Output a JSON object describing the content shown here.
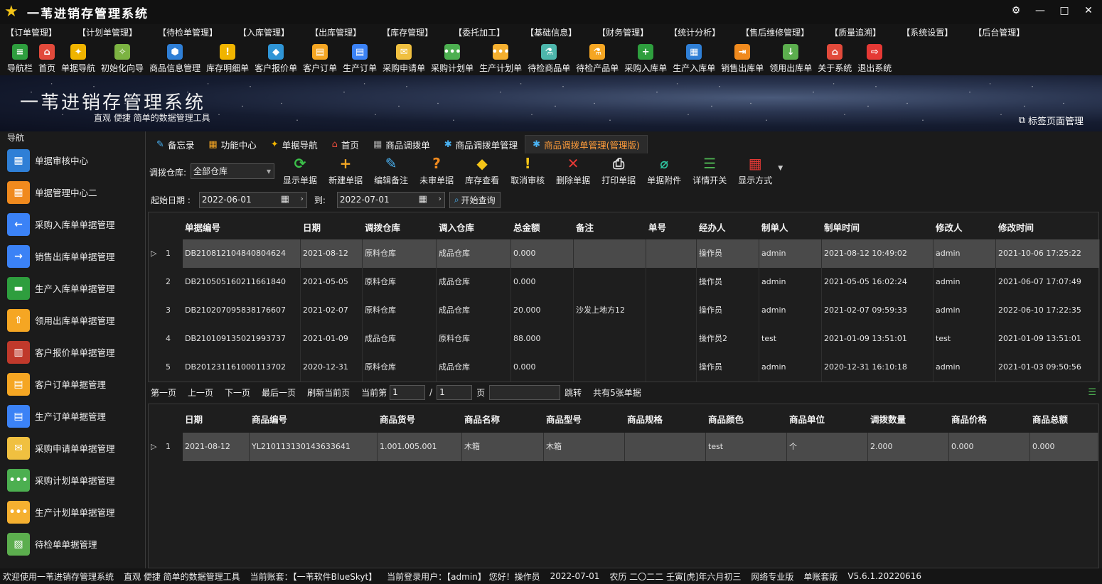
{
  "window": {
    "title": "一苇进销存管理系统",
    "buttons": [
      "⚙",
      "—",
      "□",
      "✕"
    ]
  },
  "menu": [
    "【订单管理】",
    "【计划单管理】",
    "【待检单管理】",
    "【入库管理】",
    "【出库管理】",
    "【库存管理】",
    "【委托加工】",
    "【基础信息】",
    "【财务管理】",
    "【统计分析】",
    "【售后维修管理】",
    "【质量追溯】",
    "【系统设置】",
    "【后台管理】"
  ],
  "toolbar": [
    {
      "label": "导航栏",
      "icon": "≡",
      "color": "#2e9e3e"
    },
    {
      "label": "首页",
      "icon": "⌂",
      "color": "#e24a3b"
    },
    {
      "label": "单据导航",
      "icon": "✦",
      "color": "#f0b400"
    },
    {
      "label": "初始化向导",
      "icon": "✧",
      "color": "#7cb342"
    },
    {
      "label": "商品信息管理",
      "icon": "⬢",
      "color": "#2f7fd6"
    },
    {
      "label": "库存明细单",
      "icon": "!",
      "color": "#f0b400"
    },
    {
      "label": "客户报价单",
      "icon": "◆",
      "color": "#2f95d6"
    },
    {
      "label": "客户订单",
      "icon": "▤",
      "color": "#f5a623"
    },
    {
      "label": "生产订单",
      "icon": "▤",
      "color": "#3b82f6"
    },
    {
      "label": "采购申请单",
      "icon": "✉",
      "color": "#f0c040"
    },
    {
      "label": "采购计划单",
      "icon": "•••",
      "color": "#4caf50"
    },
    {
      "label": "生产计划单",
      "icon": "•••",
      "color": "#f5b030"
    },
    {
      "label": "待检商品单",
      "icon": "⚗",
      "color": "#4db6ac"
    },
    {
      "label": "待检产品单",
      "icon": "⚗",
      "color": "#f5a623"
    },
    {
      "label": "采购入库单",
      "icon": "+",
      "color": "#2e9e3e"
    },
    {
      "label": "生产入库单",
      "icon": "▦",
      "color": "#2f7fd6"
    },
    {
      "label": "销售出库单",
      "icon": "⇥",
      "color": "#f08a1e"
    },
    {
      "label": "领用出库单",
      "icon": "↓",
      "color": "#5cae4e"
    },
    {
      "label": "关于系统",
      "icon": "⌂",
      "color": "#e24a3b"
    },
    {
      "label": "退出系统",
      "icon": "⇨",
      "color": "#e53935"
    }
  ],
  "banner": {
    "title": "一苇进销存管理系统",
    "subtitle": "直观  便捷  简单的数据管理工具",
    "tag_manager": "标签页面管理"
  },
  "nav": {
    "header": "导航",
    "items": [
      {
        "label": "单据审核中心",
        "icon": "▦",
        "color": "#2f7fd6"
      },
      {
        "label": "单据管理中心二",
        "icon": "▦",
        "color": "#f08a1e"
      },
      {
        "label": "采购入库单单据管理",
        "icon": "←",
        "color": "#3b82f6"
      },
      {
        "label": "销售出库单单据管理",
        "icon": "→",
        "color": "#3b82f6"
      },
      {
        "label": "生产入库单单据管理",
        "icon": "▬",
        "color": "#2e9e3e"
      },
      {
        "label": "领用出库单单据管理",
        "icon": "⇧",
        "color": "#f5a623"
      },
      {
        "label": "客户报价单单据管理",
        "icon": "▥",
        "color": "#c0392b"
      },
      {
        "label": "客户订单单据管理",
        "icon": "▤",
        "color": "#f5a623"
      },
      {
        "label": "生产订单单据管理",
        "icon": "▤",
        "color": "#3b82f6"
      },
      {
        "label": "采购申请单单据管理",
        "icon": "✉",
        "color": "#f0c040"
      },
      {
        "label": "采购计划单单据管理",
        "icon": "•••",
        "color": "#4caf50"
      },
      {
        "label": "生产计划单单据管理",
        "icon": "•••",
        "color": "#f5b030"
      },
      {
        "label": "待检单单据管理",
        "icon": "▧",
        "color": "#5cae4e"
      }
    ]
  },
  "tabs": [
    {
      "label": "备忘录",
      "icon": "✎",
      "color": "#4ab3f4"
    },
    {
      "label": "功能中心",
      "icon": "▦",
      "color": "#f5a623"
    },
    {
      "label": "单据导航",
      "icon": "✦",
      "color": "#f0b400"
    },
    {
      "label": "首页",
      "icon": "⌂",
      "color": "#e24a3b"
    },
    {
      "label": "商品调拨单",
      "icon": "▦",
      "color": "#aaa"
    },
    {
      "label": "商品调拨单管理",
      "icon": "✱",
      "color": "#4ab3f4"
    },
    {
      "label": "商品调拨单管理(管理版)",
      "icon": "✱",
      "color": "#4ab3f4",
      "active": true
    }
  ],
  "filters": {
    "warehouse_label": "调拨仓库:",
    "warehouse_value": "全部仓库",
    "start_label": "起始日期 :",
    "start_value": "2022-06-01",
    "to_label": "到:",
    "end_value": "2022-07-01",
    "query_label": "开始查询"
  },
  "actions": [
    {
      "label": "显示单据",
      "icon": "⟳",
      "color": "#3cc24a"
    },
    {
      "label": "新建单据",
      "icon": "+",
      "color": "#f5a623"
    },
    {
      "label": "编辑备注",
      "icon": "✎",
      "color": "#4ab3f4"
    },
    {
      "label": "未审单据",
      "icon": "?",
      "color": "#f08a1e"
    },
    {
      "label": "库存查看",
      "icon": "◆",
      "color": "#f5c518"
    },
    {
      "label": "取消审核",
      "icon": "!",
      "color": "#f5c518"
    },
    {
      "label": "删除单据",
      "icon": "✕",
      "color": "#e53935"
    },
    {
      "label": "打印单据",
      "icon": "⎙",
      "color": "#e0e0e0"
    },
    {
      "label": "单据附件",
      "icon": "⌀",
      "color": "#2ec4a0"
    },
    {
      "label": "详情开关",
      "icon": "☰",
      "color": "#4caf50"
    },
    {
      "label": "显示方式",
      "icon": "▦",
      "color": "#e53935"
    }
  ],
  "master_grid": {
    "headers": [
      "单据编号",
      "日期",
      "调拨仓库",
      "调入仓库",
      "总金额",
      "备注",
      "单号",
      "经办人",
      "制单人",
      "制单时间",
      "修改人",
      "修改时间"
    ],
    "rows": [
      {
        "n": "1",
        "c": [
          "DB210812104840804624",
          "2021-08-12",
          "原料仓库",
          "成品仓库",
          "0.000",
          "",
          "",
          "操作员",
          "admin",
          "2021-08-12 10:49:02",
          "admin",
          "2021-10-06 17:25:22"
        ]
      },
      {
        "n": "2",
        "c": [
          "DB210505160211661840",
          "2021-05-05",
          "原料仓库",
          "成品仓库",
          "0.000",
          "",
          "",
          "操作员",
          "admin",
          "2021-05-05 16:02:24",
          "admin",
          "2021-06-07 17:07:49"
        ]
      },
      {
        "n": "3",
        "c": [
          "DB210207095838176607",
          "2021-02-07",
          "原料仓库",
          "成品仓库",
          "20.000",
          "沙发上地方12",
          "",
          "操作员",
          "admin",
          "2021-02-07 09:59:33",
          "admin",
          "2022-06-10 17:22:35"
        ]
      },
      {
        "n": "4",
        "c": [
          "DB210109135021993737",
          "2021-01-09",
          "成品仓库",
          "原料仓库",
          "88.000",
          "",
          "",
          "操作员2",
          "test",
          "2021-01-09 13:51:01",
          "test",
          "2021-01-09 13:51:01"
        ]
      },
      {
        "n": "5",
        "c": [
          "DB201231161000113702",
          "2020-12-31",
          "原料仓库",
          "成品仓库",
          "0.000",
          "",
          "",
          "操作员",
          "admin",
          "2020-12-31 16:10:18",
          "admin",
          "2021-01-03 09:50:56"
        ]
      }
    ]
  },
  "pager": {
    "first": "第一页",
    "prev": "上一页",
    "next": "下一页",
    "last": "最后一页",
    "refresh": "刷新当前页",
    "current_label": "当前第",
    "current": "1",
    "slash": "/",
    "total_pages": "1",
    "page_unit": "页",
    "jump_value": "",
    "jump_label": "跳转",
    "total_text": "共有5张单据"
  },
  "detail_grid": {
    "headers": [
      "日期",
      "商品编号",
      "商品货号",
      "商品名称",
      "商品型号",
      "商品规格",
      "商品颜色",
      "商品单位",
      "调拨数量",
      "商品价格",
      "商品总额"
    ],
    "rows": [
      {
        "n": "1",
        "c": [
          "2021-08-12",
          "YL210113130143633641",
          "1.001.005.001",
          "木箱",
          "木箱",
          "",
          "test",
          "个",
          "2.000",
          "0.000",
          "0.000"
        ]
      }
    ]
  },
  "status": [
    "欢迎使用一苇进销存管理系统",
    "直观 便捷 简单的数据管理工具",
    "当前账套：【一苇软件BlueSkyt】",
    "当前登录用户：【admin】 您好！操作员",
    "2022-07-01",
    "农历 二〇二二 壬寅[虎]年六月初三",
    "网络专业版",
    "单账套版",
    "V5.6.1.20220616"
  ]
}
